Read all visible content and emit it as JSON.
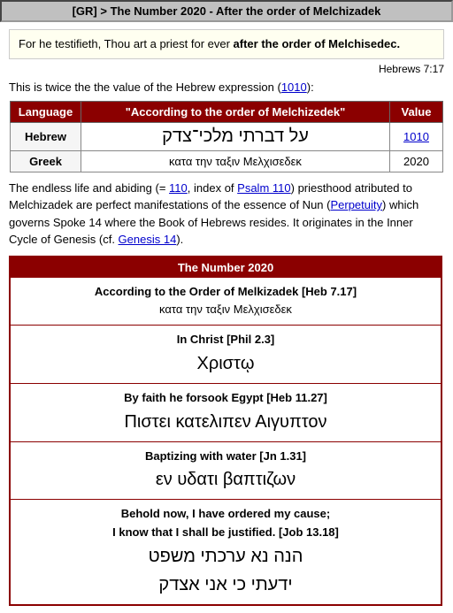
{
  "header": {
    "label": "[GR] > The Number 2020 - After the order of Melchizadek"
  },
  "scripture": {
    "text_plain": "For he testifieth, Thou art a priest for ever ",
    "text_bold": "after the order of Melchisedec.",
    "reference": "Hebrews 7:17"
  },
  "intro": {
    "text_before": "This is twice the the value of the Hebrew expression (",
    "link_text": "1010",
    "link_href": "#1010",
    "text_after": "):"
  },
  "table": {
    "col1": "Language",
    "col2": "\"According to the order of Melchizedek\"",
    "col3": "Value",
    "rows": [
      {
        "language": "Hebrew",
        "phrase": "על דברתי מלכי־צדק",
        "value": "1010",
        "value_link": true,
        "hebrew": true
      },
      {
        "language": "Greek",
        "phrase": "κατα την ταξιν Μελχισεδεκ",
        "value": "2020",
        "value_link": false,
        "hebrew": false
      }
    ]
  },
  "body_paragraph": {
    "text": "The endless life and abiding (= ",
    "link1_text": "110",
    "link1_href": "#110",
    "text2": ", index of ",
    "link2_text": "Psalm 110",
    "link2_href": "#psalm110",
    "text3": ") priesthood atributed to Melchizadek are perfect manifestations of the essence of Nun (",
    "link3_text": "Perpetuity",
    "link3_href": "#perpetuity",
    "text4": ") which governs Spoke 14 where the Book of Hebrews resides. It originates in the Inner Cycle of Genesis (cf. ",
    "link4_text": "Genesis 14",
    "link4_href": "#genesis14",
    "text5": ")."
  },
  "num2020": {
    "title": "The Number 2020",
    "rows": [
      {
        "label": "According to the Order of Melkizadek [Heb 7.17]",
        "greek": "κατα την ταξιν Μελχισεδεκ",
        "greek_large": false
      },
      {
        "label": "In Christ [Phil 2.3]",
        "greek": "Χριστῳ",
        "greek_large": true
      },
      {
        "label": "By faith he forsook Egypt [Heb 11.27]",
        "greek": "Πιστει κατελιπεν Αιγυπτον",
        "greek_large": true
      },
      {
        "label": "Baptizing with water [Jn 1.31]",
        "greek": "εν υδατι βαπτιζων",
        "greek_large": true
      },
      {
        "label": "Behold now, I have ordered my cause;\nI know that I shall be justified. [Job 13.18]",
        "hebrew1": "הנה נא ערכתי משפט",
        "hebrew2": "ידעתי כי אני אצדק",
        "greek_large": false,
        "is_hebrew": true
      }
    ]
  }
}
